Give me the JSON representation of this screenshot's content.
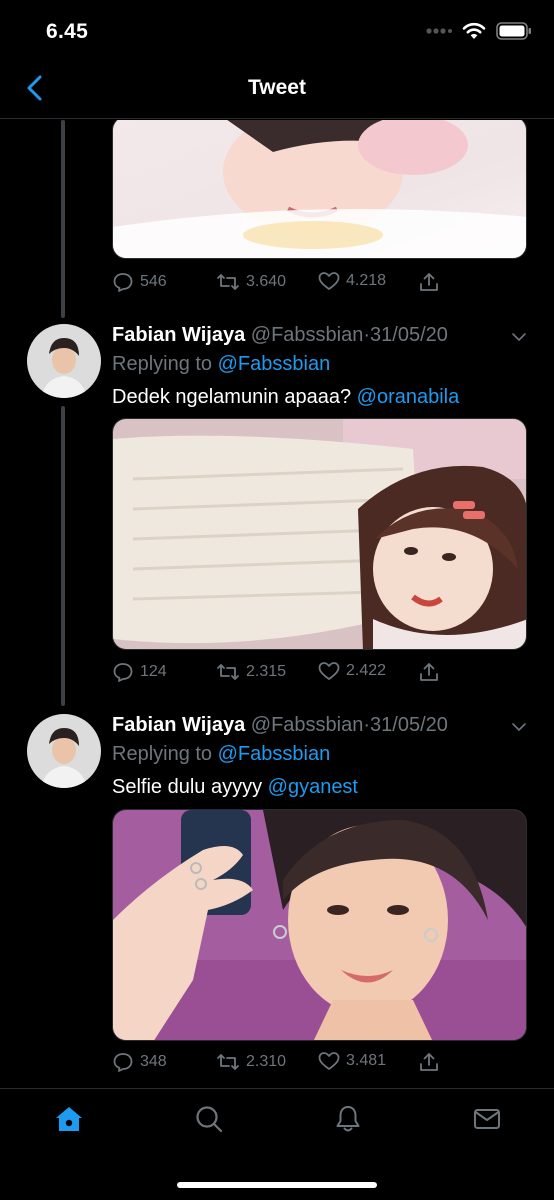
{
  "status_bar": {
    "time": "6.45"
  },
  "nav": {
    "title": "Tweet"
  },
  "tweets": [
    {
      "actions": {
        "replies": "546",
        "retweets": "3.640",
        "likes": "4.218"
      }
    },
    {
      "name": "Fabian Wijaya",
      "handle": "@Fabssbian",
      "date": "31/05/20",
      "replying_prefix": "Replying to",
      "replying_to": "@Fabssbian",
      "text": "Dedek ngelamunin apaaa?",
      "mention": "@oranabila",
      "actions": {
        "replies": "124",
        "retweets": "2.315",
        "likes": "2.422"
      }
    },
    {
      "name": "Fabian Wijaya",
      "handle": "@Fabssbian",
      "date": "31/05/20",
      "replying_prefix": "Replying to",
      "replying_to": "@Fabssbian",
      "text": "Selfie dulu ayyyy",
      "mention": "@gyanest",
      "actions": {
        "replies": "348",
        "retweets": "2.310",
        "likes": "3.481"
      }
    }
  ],
  "colors": {
    "accent": "#1d9bf0",
    "muted": "#6e767d",
    "background": "#000000",
    "divider": "#2a2d30"
  },
  "icons": {
    "status": [
      "signal-icon",
      "wifi-icon",
      "battery-icon"
    ],
    "nav": [
      "back-chevron-icon"
    ],
    "tweet_actions": [
      "reply-icon",
      "retweet-icon",
      "like-icon",
      "share-icon"
    ],
    "tabs": [
      "home-icon",
      "search-icon",
      "notifications-icon",
      "messages-icon"
    ]
  }
}
